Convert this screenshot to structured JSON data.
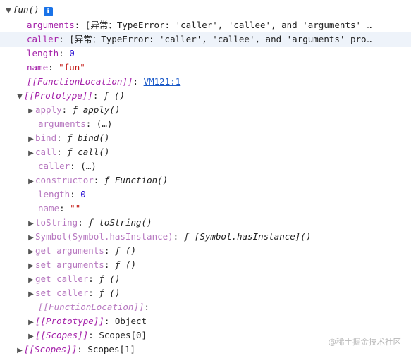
{
  "root": {
    "label": "fun()"
  },
  "rows": [
    {
      "key": "arguments",
      "sep": ": ",
      "val": "[异常：TypeError: 'caller', 'callee', and 'arguments' …"
    },
    {
      "key": "caller",
      "sep": ": ",
      "val": "[异常：TypeError: 'caller', 'callee', and 'arguments' pro…"
    },
    {
      "key": "length",
      "sep": ": ",
      "val": "0"
    },
    {
      "key": "name",
      "sep": ": ",
      "val": "\"fun\""
    },
    {
      "key": "[[FunctionLocation]]",
      "sep": ": ",
      "val": "VM121:1"
    },
    {
      "key": "[[Prototype]]",
      "sep": ": ",
      "val": "ƒ ()"
    },
    {
      "key": "apply",
      "sep": ": ",
      "val": "ƒ apply()"
    },
    {
      "key": "arguments",
      "sep": ": ",
      "val": "(…)"
    },
    {
      "key": "bind",
      "sep": ": ",
      "val": "ƒ bind()"
    },
    {
      "key": "call",
      "sep": ": ",
      "val": "ƒ call()"
    },
    {
      "key": "caller",
      "sep": ": ",
      "val": "(…)"
    },
    {
      "key": "constructor",
      "sep": ": ",
      "val": "ƒ Function()"
    },
    {
      "key": "length",
      "sep": ": ",
      "val": "0"
    },
    {
      "key": "name",
      "sep": ": ",
      "val": "\"\""
    },
    {
      "key": "toString",
      "sep": ": ",
      "val": "ƒ toString()"
    },
    {
      "key": "Symbol(Symbol.hasInstance)",
      "sep": ": ",
      "val": "ƒ [Symbol.hasInstance]()"
    },
    {
      "key": "get arguments",
      "sep": ": ",
      "val": "ƒ ()"
    },
    {
      "key": "set arguments",
      "sep": ": ",
      "val": "ƒ ()"
    },
    {
      "key": "get caller",
      "sep": ": ",
      "val": "ƒ ()"
    },
    {
      "key": "set caller",
      "sep": ": ",
      "val": "ƒ ()"
    },
    {
      "key": "[[FunctionLocation]]",
      "sep": ": ",
      "val": ""
    },
    {
      "key": "[[Prototype]]",
      "sep": ": ",
      "val": "Object"
    },
    {
      "key": "[[Scopes]]",
      "sep": ": ",
      "val": "Scopes[0]"
    },
    {
      "key": "[[Scopes]]",
      "sep": ": ",
      "val": "Scopes[1]"
    }
  ],
  "watermark": "@稀土掘金技术社区",
  "colors": {
    "key": "#a31ea8",
    "string": "#c41a16",
    "number": "#1c00cf",
    "link": "#1a59c8",
    "highlight": "#eef3fa"
  }
}
